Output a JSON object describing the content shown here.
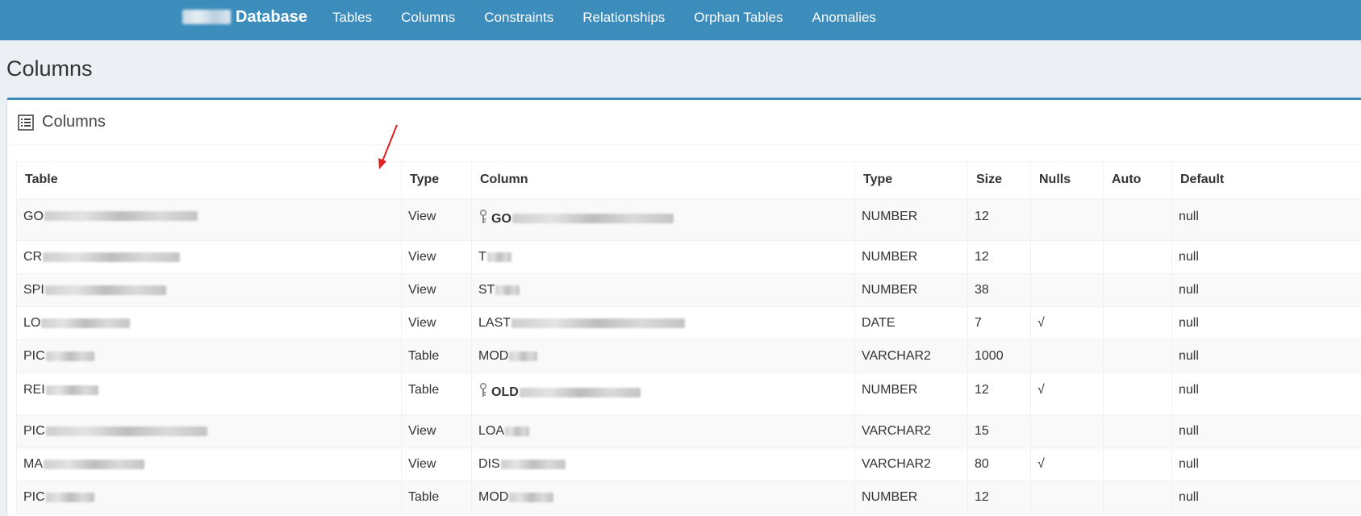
{
  "navbar": {
    "brand": "Database",
    "links": [
      "Tables",
      "Columns",
      "Constraints",
      "Relationships",
      "Orphan Tables",
      "Anomalies"
    ]
  },
  "page": {
    "title": "Columns",
    "box_title": "Columns"
  },
  "table": {
    "headers": [
      "Table",
      "Type",
      "Column",
      "Type",
      "Size",
      "Nulls",
      "Auto",
      "Default"
    ],
    "rows": [
      {
        "table": "GO",
        "table_blur": 190,
        "type": "View",
        "column": "GO",
        "column_blur": 200,
        "pk": true,
        "datatype": "NUMBER",
        "size": "12",
        "nulls": "",
        "auto": "",
        "default": "null"
      },
      {
        "table": "CR",
        "table_blur": 170,
        "type": "View",
        "column": "T",
        "column_blur": 30,
        "pk": false,
        "datatype": "NUMBER",
        "size": "12",
        "nulls": "",
        "auto": "",
        "default": "null"
      },
      {
        "table": "SPI",
        "table_blur": 150,
        "type": "View",
        "column": "ST",
        "column_blur": 30,
        "pk": false,
        "datatype": "NUMBER",
        "size": "38",
        "nulls": "",
        "auto": "",
        "default": "null"
      },
      {
        "table": "LO",
        "table_blur": 110,
        "type": "View",
        "column": "LAST",
        "column_blur": 215,
        "pk": false,
        "datatype": "DATE",
        "size": "7",
        "nulls": "√",
        "auto": "",
        "default": "null"
      },
      {
        "table": "PIC",
        "table_blur": 60,
        "type": "Table",
        "column": "MOD",
        "column_blur": 35,
        "pk": false,
        "datatype": "VARCHAR2",
        "size": "1000",
        "nulls": "",
        "auto": "",
        "default": "null"
      },
      {
        "table": "REI",
        "table_blur": 65,
        "type": "Table",
        "column": "OLD",
        "column_blur": 150,
        "pk": true,
        "datatype": "NUMBER",
        "size": "12",
        "nulls": "√",
        "auto": "",
        "default": "null"
      },
      {
        "table": "PIC",
        "table_blur": 200,
        "type": "View",
        "column": "LOA",
        "column_blur": 30,
        "pk": false,
        "datatype": "VARCHAR2",
        "size": "15",
        "nulls": "",
        "auto": "",
        "default": "null"
      },
      {
        "table": "MA",
        "table_blur": 125,
        "type": "View",
        "column": "DIS",
        "column_blur": 80,
        "pk": false,
        "datatype": "VARCHAR2",
        "size": "80",
        "nulls": "√",
        "auto": "",
        "default": "null"
      },
      {
        "table": "PIC",
        "table_blur": 60,
        "type": "Table",
        "column": "MOD",
        "column_blur": 55,
        "pk": false,
        "datatype": "NUMBER",
        "size": "12",
        "nulls": "",
        "auto": "",
        "default": "null"
      }
    ]
  },
  "colors": {
    "navbar": "#3c8dbc",
    "background": "#ecf0f5",
    "annotation_arrow": "#e02020"
  },
  "icons": {
    "box_header": "list-icon",
    "primary_key": "key-icon",
    "annotation": "red-arrow"
  }
}
